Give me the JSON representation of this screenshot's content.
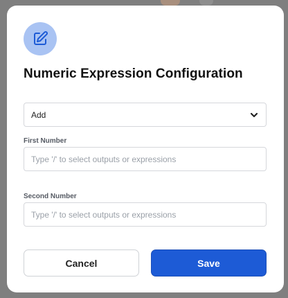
{
  "colors": {
    "accent": "#1d5bd6",
    "icon_circle_bg": "#a9c3f3",
    "icon_stroke": "#1d5bd6"
  },
  "dialog": {
    "icon": "edit-icon",
    "title": "Numeric Expression Configuration",
    "operation_select": {
      "value": "Add",
      "chevron_icon": "chevron-down-icon"
    },
    "first_number": {
      "label": "First Number",
      "placeholder": "Type '/' to select outputs or expressions",
      "value": ""
    },
    "second_number": {
      "label": "Second Number",
      "placeholder": "Type '/' to select outputs or expressions",
      "value": ""
    },
    "cancel_label": "Cancel",
    "save_label": "Save"
  }
}
